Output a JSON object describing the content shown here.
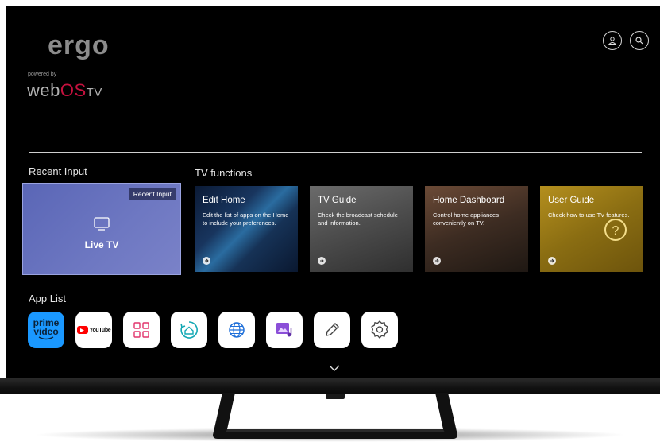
{
  "brand": {
    "logo": "ergo",
    "powered_by": "powered by",
    "webos_a": "web",
    "webos_b": "OS",
    "webos_c": "TV"
  },
  "top_icons": [
    "profile-icon",
    "search-icon"
  ],
  "recent_input": {
    "section_label": "Recent Input",
    "tag": "Recent Input",
    "name": "Live TV",
    "icon": "tv-icon"
  },
  "tv_functions": {
    "section_label": "TV functions",
    "cards": [
      {
        "title": "Edit Home",
        "desc": "Edit the list of apps on the Home to include your preferences."
      },
      {
        "title": "TV Guide",
        "desc": "Check the broadcast schedule and information."
      },
      {
        "title": "Home Dashboard",
        "desc": "Control home appliances conveniently on TV."
      },
      {
        "title": "User Guide",
        "desc": "Check how to use TV features."
      }
    ]
  },
  "app_list": {
    "section_label": "App List",
    "apps": [
      {
        "name": "prime video",
        "line1": "prime",
        "line2": "video",
        "color": "#1a98ff"
      },
      {
        "name": "YouTube",
        "label": "YouTube",
        "color": "#ff0000"
      },
      {
        "name": "apps",
        "icon": "grid-icon",
        "color": "#e2336b"
      },
      {
        "name": "home-dashboard",
        "icon": "home-sync-icon",
        "color": "#13a8b4"
      },
      {
        "name": "web-browser",
        "icon": "globe-icon",
        "color": "#1e6fd9"
      },
      {
        "name": "gallery-music",
        "icon": "media-icon",
        "color": "#8b4fd8"
      },
      {
        "name": "edit",
        "icon": "pencil-icon",
        "color": "#444444"
      },
      {
        "name": "settings",
        "icon": "gear-icon",
        "color": "#444444"
      }
    ]
  },
  "more_icon": "chevron-down-icon"
}
